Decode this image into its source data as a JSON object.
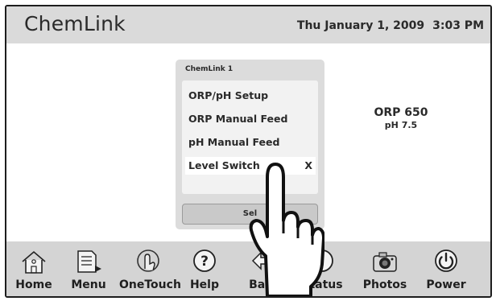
{
  "header": {
    "brand": "ChemLink",
    "date": "Thu January 1, 2009",
    "time": "3:03 PM"
  },
  "dialog": {
    "title": "ChemLink 1",
    "items": [
      {
        "label": "ORP/pH Setup",
        "mark": ""
      },
      {
        "label": "ORP Manual Feed",
        "mark": ""
      },
      {
        "label": "pH Manual Feed",
        "mark": ""
      },
      {
        "label": "Level Switch",
        "mark": "X"
      }
    ],
    "select_label": "Sel"
  },
  "reading": {
    "orp": "ORP 650",
    "ph": "pH 7.5"
  },
  "nav": [
    {
      "label": "Home",
      "icon": "home-icon"
    },
    {
      "label": "Menu",
      "icon": "menu-icon"
    },
    {
      "label": "OneTouch",
      "icon": "onetouch-icon"
    },
    {
      "label": "Help",
      "icon": "help-icon"
    },
    {
      "label": "Back",
      "icon": "back-icon"
    },
    {
      "label": "Status",
      "icon": "status-icon"
    },
    {
      "label": "Photos",
      "icon": "camera-icon"
    },
    {
      "label": "Power",
      "icon": "power-icon"
    }
  ],
  "colors": {
    "header_bg": "#dadada",
    "footer_bg": "#d4d4d4",
    "dialog_bg": "#dcdcdc",
    "text": "#2a2a2a"
  }
}
